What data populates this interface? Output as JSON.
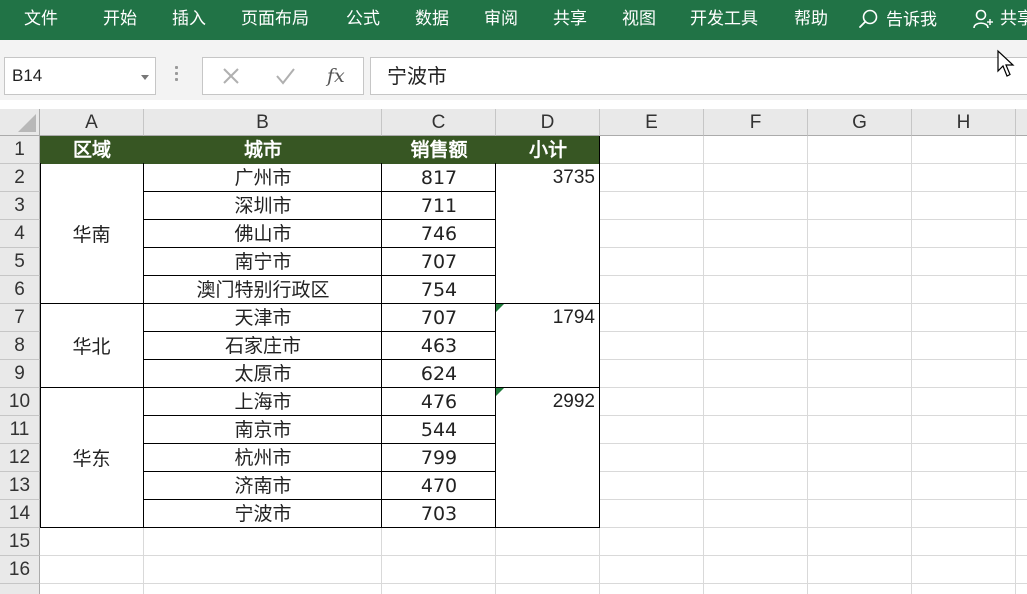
{
  "ribbon": {
    "tabs": [
      "文件",
      "开始",
      "插入",
      "页面布局",
      "公式",
      "数据",
      "审阅",
      "共享",
      "视图",
      "开发工具",
      "帮助"
    ],
    "tell_me": "告诉我",
    "share": "共享"
  },
  "formula_bar": {
    "name_box": "B14",
    "fx_label": "fx",
    "value": "宁波市"
  },
  "grid": {
    "columns": [
      "A",
      "B",
      "C",
      "D",
      "E",
      "F",
      "G",
      "H"
    ],
    "rows": [
      "1",
      "2",
      "3",
      "4",
      "5",
      "6",
      "7",
      "8",
      "9",
      "10",
      "11",
      "12",
      "13",
      "14",
      "15",
      "16"
    ],
    "header": [
      "区域",
      "城市",
      "销售额",
      "小计"
    ],
    "regions": [
      {
        "name": "华南",
        "subtotal": "3735"
      },
      {
        "name": "华北",
        "subtotal": "1794"
      },
      {
        "name": "华东",
        "subtotal": "2992"
      }
    ],
    "records": [
      {
        "city": "广州市",
        "sales": "817"
      },
      {
        "city": "深圳市",
        "sales": "711"
      },
      {
        "city": "佛山市",
        "sales": "746"
      },
      {
        "city": "南宁市",
        "sales": "707"
      },
      {
        "city": "澳门特别行政区",
        "sales": "754"
      },
      {
        "city": "天津市",
        "sales": "707"
      },
      {
        "city": "石家庄市",
        "sales": "463"
      },
      {
        "city": "太原市",
        "sales": "624"
      },
      {
        "city": "上海市",
        "sales": "476"
      },
      {
        "city": "南京市",
        "sales": "544"
      },
      {
        "city": "杭州市",
        "sales": "799"
      },
      {
        "city": "济南市",
        "sales": "470"
      },
      {
        "city": "宁波市",
        "sales": "703"
      }
    ]
  },
  "colors": {
    "ribbon_bg": "#217346",
    "header_fill": "#375623",
    "header_text": "#ffffff"
  }
}
